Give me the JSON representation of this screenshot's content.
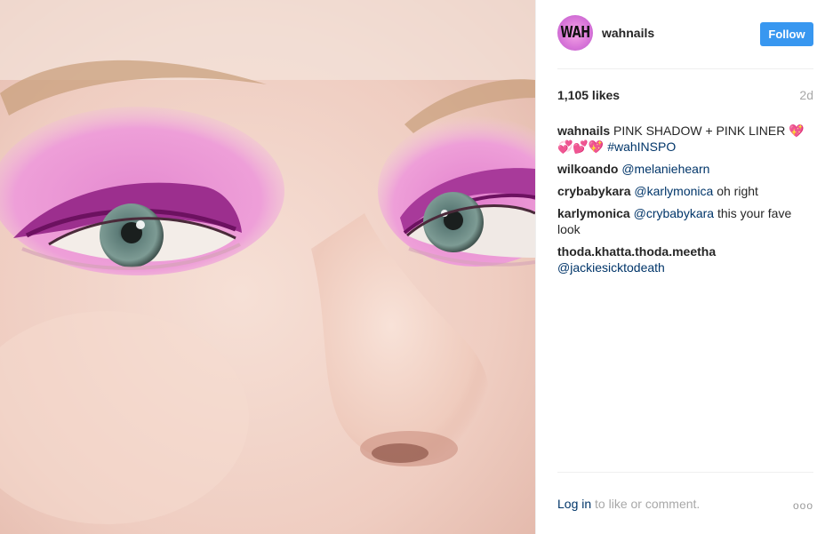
{
  "post": {
    "photo_alt": "Close-up of eyes with pink eyeshadow and liner",
    "header": {
      "avatar_text": "WAH",
      "username": "wahnails",
      "follow_label": "Follow"
    },
    "stats": {
      "likes": "1,105 likes",
      "age": "2d"
    },
    "caption": {
      "author": "wahnails",
      "text": "PINK SHADOW + PINK LINER 💖💞💕💖",
      "hashtag": "#wahINSPO"
    },
    "comments": [
      {
        "author": "wilkoando",
        "mention": "@melaniehearn",
        "text": ""
      },
      {
        "author": "crybabykara",
        "mention": "@karlymonica",
        "text": "oh right"
      },
      {
        "author": "karlymonica",
        "mention": "@crybabykara",
        "text": "this your fave look"
      },
      {
        "author": "thoda.khatta.thoda.meetha",
        "mention": "@jackiesicktodeath",
        "text": ""
      }
    ],
    "footer": {
      "login_label": "Log in",
      "login_suffix": "to like or comment.",
      "more_icon": "ooo"
    },
    "colors": {
      "accent": "#3897f0",
      "link": "#003569",
      "muted": "#a8a8a8"
    }
  }
}
